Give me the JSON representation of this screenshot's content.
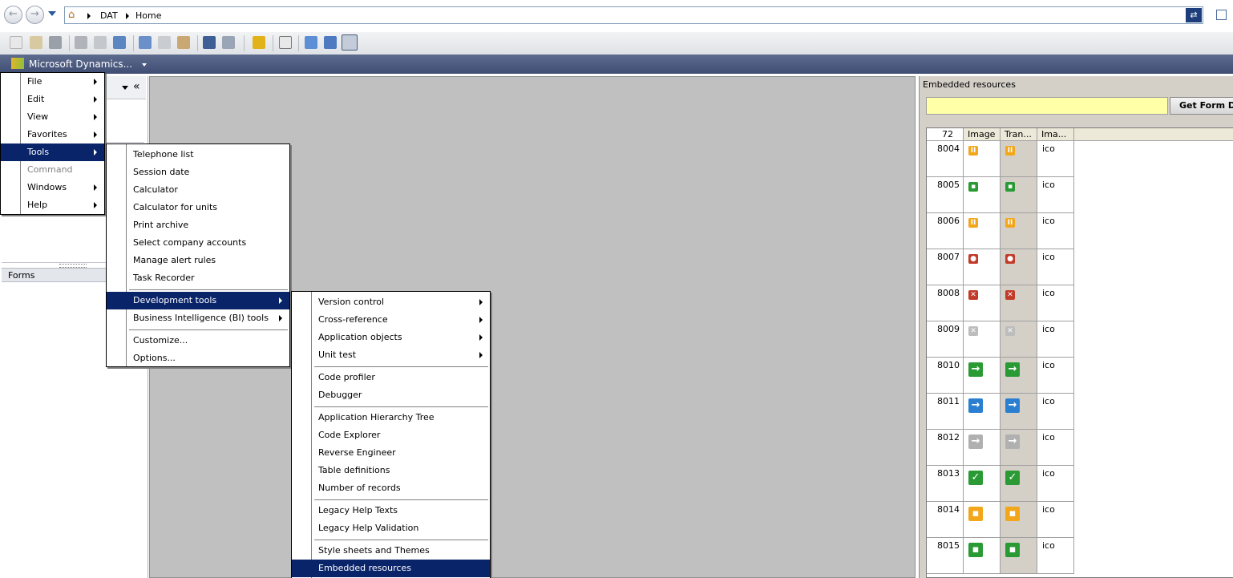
{
  "address": {
    "crumbs": [
      "DAT",
      "Home"
    ]
  },
  "menubar": {
    "app_label": "Microsoft Dynamics..."
  },
  "navpane": {
    "forms_label": "Forms",
    "collapse_glyph": "«"
  },
  "main_menu": {
    "items": [
      {
        "label": "File"
      },
      {
        "label": "Edit"
      },
      {
        "label": "View"
      },
      {
        "label": "Favorites"
      },
      {
        "label": "Tools"
      },
      {
        "label": "Command"
      },
      {
        "label": "Windows"
      },
      {
        "label": "Help"
      }
    ]
  },
  "tools_menu": {
    "items": [
      {
        "label": "Telephone list"
      },
      {
        "label": "Session date"
      },
      {
        "label": "Calculator"
      },
      {
        "label": "Calculator for units"
      },
      {
        "label": "Print archive"
      },
      {
        "label": "Select company accounts"
      },
      {
        "label": "Manage alert rules"
      },
      {
        "label": "Task Recorder"
      },
      {
        "label": "Development tools"
      },
      {
        "label": "Business Intelligence (BI) tools"
      },
      {
        "label": "Customize..."
      },
      {
        "label": "Options..."
      }
    ]
  },
  "dev_menu": {
    "items": [
      {
        "label": "Version control"
      },
      {
        "label": "Cross-reference"
      },
      {
        "label": "Application objects"
      },
      {
        "label": "Unit test"
      },
      {
        "label": "Code profiler"
      },
      {
        "label": "Debugger"
      },
      {
        "label": "Application Hierarchy Tree"
      },
      {
        "label": "Code Explorer"
      },
      {
        "label": "Reverse Engineer"
      },
      {
        "label": "Table definitions"
      },
      {
        "label": "Number of records"
      },
      {
        "label": "Legacy Help Texts"
      },
      {
        "label": "Legacy Help Validation"
      },
      {
        "label": "Style sheets and Themes"
      },
      {
        "label": "Embedded resources"
      }
    ]
  },
  "embedded": {
    "title": "Embedded resources",
    "button_label": "Get Form Details",
    "columns": [
      "72",
      "Image",
      "Tran...",
      "Ima..."
    ],
    "rows": [
      {
        "id": "8004",
        "type": "ico",
        "icon": "pause-icon",
        "color": "#f2a71b"
      },
      {
        "id": "8005",
        "type": "ico",
        "icon": "battery-icon",
        "color": "#2a9a35"
      },
      {
        "id": "8006",
        "type": "ico",
        "icon": "pause-icon",
        "color": "#f2a71b"
      },
      {
        "id": "8007",
        "type": "ico",
        "icon": "stop-icon",
        "color": "#c23a2a"
      },
      {
        "id": "8008",
        "type": "ico",
        "icon": "cross-icon",
        "color": "#c23a2a"
      },
      {
        "id": "8009",
        "type": "ico",
        "icon": "cross-icon",
        "color": "#bdbdbd"
      },
      {
        "id": "8010",
        "type": "ico",
        "icon": "arrow-right-icon",
        "color": "#2a9a35"
      },
      {
        "id": "8011",
        "type": "ico",
        "icon": "arrow-right-icon",
        "color": "#2a7fd0"
      },
      {
        "id": "8012",
        "type": "ico",
        "icon": "arrow-right-icon",
        "color": "#b0b0b0"
      },
      {
        "id": "8013",
        "type": "ico",
        "icon": "check-icon",
        "color": "#2a9a35"
      },
      {
        "id": "8014",
        "type": "ico",
        "icon": "battery-icon",
        "color": "#f2a71b"
      },
      {
        "id": "8015",
        "type": "ico",
        "icon": "battery-icon",
        "color": "#2a9a35"
      }
    ]
  }
}
